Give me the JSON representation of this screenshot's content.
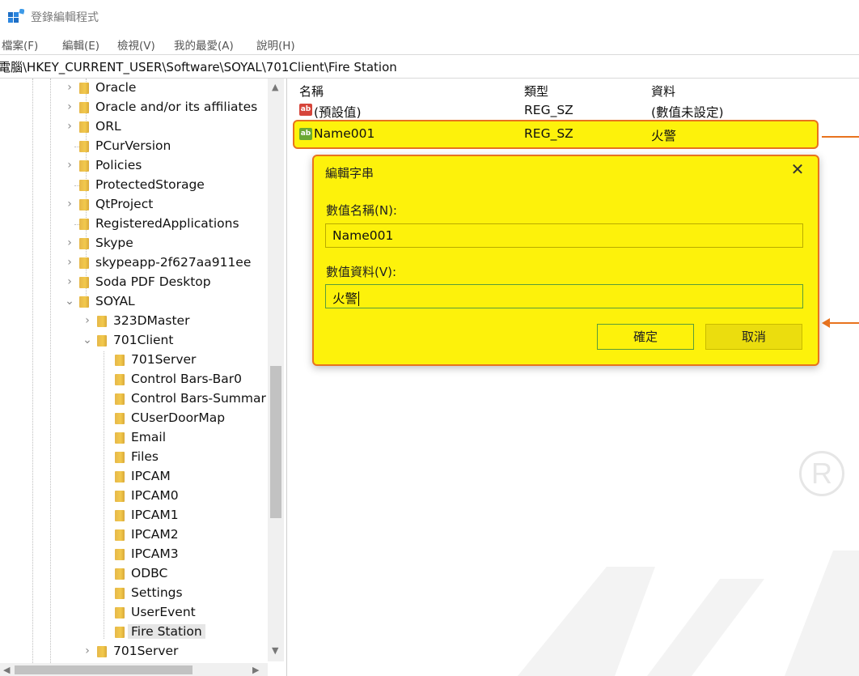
{
  "window": {
    "title": "登錄編輯程式",
    "app_icon": "registry-editor-icon"
  },
  "menu": {
    "items": [
      {
        "label": "檔案(F)"
      },
      {
        "label": "編輯(E)"
      },
      {
        "label": "檢視(V)"
      },
      {
        "label": "我的最愛(A)"
      },
      {
        "label": "說明(H)"
      }
    ]
  },
  "address": {
    "path": "電腦\\HKEY_CURRENT_USER\\Software\\SOYAL\\701Client\\Fire Station"
  },
  "tree": {
    "items": [
      {
        "label": "Oracle",
        "expander": "›"
      },
      {
        "label": "Oracle and/or its affiliates",
        "expander": "›"
      },
      {
        "label": "ORL",
        "expander": "›"
      },
      {
        "label": "PCurVersion",
        "expander": ""
      },
      {
        "label": "Policies",
        "expander": "›"
      },
      {
        "label": "ProtectedStorage",
        "expander": ""
      },
      {
        "label": "QtProject",
        "expander": "›"
      },
      {
        "label": "RegisteredApplications",
        "expander": ""
      },
      {
        "label": "Skype",
        "expander": "›"
      },
      {
        "label": "skypeapp-2f627aa911ee",
        "expander": "›"
      },
      {
        "label": "Soda PDF Desktop",
        "expander": "›"
      },
      {
        "label": "SOYAL",
        "expander": "⌄"
      },
      {
        "label": "323DMaster",
        "expander": "›"
      },
      {
        "label": "701Client",
        "expander": "⌄"
      },
      {
        "label": "701Server",
        "expander": ""
      },
      {
        "label": "Control Bars-Bar0",
        "expander": ""
      },
      {
        "label": "Control Bars-Summar",
        "expander": ""
      },
      {
        "label": "CUserDoorMap",
        "expander": ""
      },
      {
        "label": "Email",
        "expander": ""
      },
      {
        "label": "Files",
        "expander": ""
      },
      {
        "label": "IPCAM",
        "expander": ""
      },
      {
        "label": "IPCAM0",
        "expander": ""
      },
      {
        "label": "IPCAM1",
        "expander": ""
      },
      {
        "label": "IPCAM2",
        "expander": ""
      },
      {
        "label": "IPCAM3",
        "expander": ""
      },
      {
        "label": "ODBC",
        "expander": ""
      },
      {
        "label": "Settings",
        "expander": ""
      },
      {
        "label": "UserEvent",
        "expander": ""
      },
      {
        "label": "Fire Station",
        "expander": ""
      },
      {
        "label": "701Server",
        "expander": "›"
      }
    ],
    "selected": "Fire Station"
  },
  "list": {
    "headers": {
      "name": "名稱",
      "type": "類型",
      "data": "資料"
    },
    "rows": [
      {
        "name": "(預設值)",
        "type": "REG_SZ",
        "data": "(數值未設定)",
        "icon": "ab"
      },
      {
        "name": "Name001",
        "type": "REG_SZ",
        "data": "火警",
        "icon": "ab"
      }
    ]
  },
  "dialog": {
    "title": "編輯字串",
    "name_label": "數值名稱(N):",
    "name_value": "Name001",
    "data_label": "數值資料(V):",
    "data_value": "火警",
    "ok_label": "確定",
    "cancel_label": "取消"
  },
  "watermark": {
    "symbol": "R"
  },
  "colors": {
    "highlight": "#fdf20b",
    "callout": "#e8731e",
    "focus": "#5a9c3a"
  }
}
